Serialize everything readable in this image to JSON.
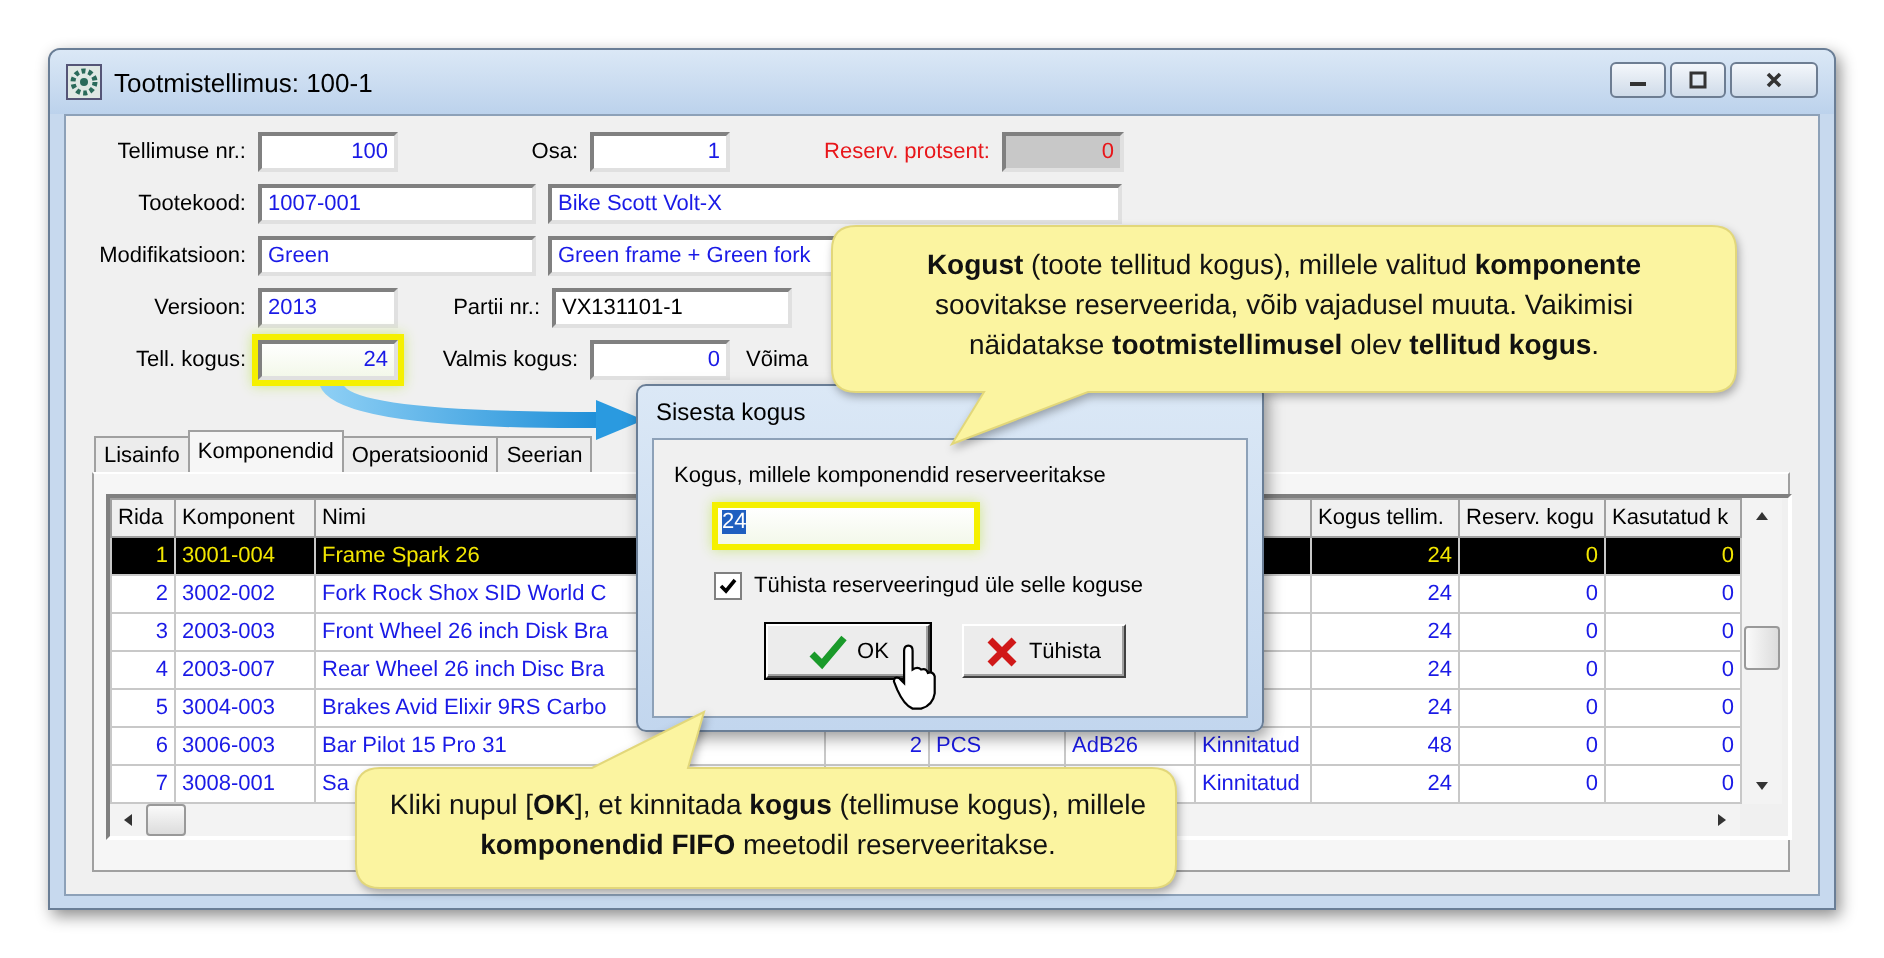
{
  "window": {
    "title": "Tootmistellimus: 100-1"
  },
  "form": {
    "rows": [
      [
        {
          "label": "Tellimuse nr.:",
          "value": "100",
          "kind": "number",
          "highlighted": false
        },
        {
          "label": "Osa:",
          "value": "1",
          "kind": "number",
          "highlighted": false
        },
        {
          "label": "Reserv. protsent:",
          "value": "0",
          "kind": "readonly",
          "highlighted": false
        }
      ],
      [
        {
          "label": "Tootekood:",
          "value": "1007-001",
          "kind": "text",
          "highlighted": false
        },
        {
          "value": "Bike Scott Volt-X",
          "kind": "text",
          "highlighted": false
        }
      ],
      [
        {
          "label": "Modifikatsioon:",
          "value": "Green",
          "kind": "text",
          "highlighted": false
        },
        {
          "value": "Green frame + Green fork",
          "kind": "text",
          "highlighted": false
        }
      ],
      [
        {
          "label": "Versioon:",
          "value": "2013",
          "kind": "text",
          "highlighted": false
        },
        {
          "label": "Partii nr.:",
          "value": "VX131101-1",
          "kind": "plain",
          "highlighted": false
        }
      ],
      [
        {
          "label": "Tell. kogus:",
          "value": "24",
          "kind": "number",
          "highlighted": true
        },
        {
          "label": "Valmis kogus:",
          "value": "0",
          "kind": "number",
          "highlighted": false
        },
        {
          "label": "Võima",
          "kind": "label_only"
        }
      ]
    ]
  },
  "tabs": [
    {
      "label": "Lisainfo",
      "selected": false
    },
    {
      "label": "Komponendid",
      "selected": true
    },
    {
      "label": "Operatsioonid",
      "selected": false
    },
    {
      "label": "Seerian",
      "selected": false
    }
  ],
  "table": {
    "columns": [
      "Rida",
      "Komponent",
      "Nimi",
      "Kogus tellim.",
      "Reserv. kogu",
      "Kasutatud k"
    ],
    "rows": [
      {
        "rida": "1",
        "komponent": "3001-004",
        "nimi": "Frame Spark 26",
        "kogus_tellim": "24",
        "reserv_kogu": "0",
        "kasutatud_k": "0",
        "selected": true
      },
      {
        "rida": "2",
        "komponent": "3002-002",
        "nimi": "Fork Rock Shox SID World C",
        "kogus_tellim": "24",
        "reserv_kogu": "0",
        "kasutatud_k": "0",
        "selected": false
      },
      {
        "rida": "3",
        "komponent": "2003-003",
        "nimi": "Front Wheel 26 inch Disk Bra",
        "kogus_tellim": "24",
        "reserv_kogu": "0",
        "kasutatud_k": "0",
        "selected": false
      },
      {
        "rida": "4",
        "komponent": "2003-007",
        "nimi": "Rear Wheel 26 inch Disc Bra",
        "kogus_tellim": "24",
        "reserv_kogu": "0",
        "kasutatud_k": "0",
        "selected": false
      },
      {
        "rida": "5",
        "komponent": "3004-003",
        "nimi": "Brakes Avid Elixir 9RS Carbo",
        "kogus_tellim": "24",
        "reserv_kogu": "0",
        "kasutatud_k": "0",
        "selected": false
      },
      {
        "rida": "6",
        "komponent": "3006-003",
        "nimi": "Bar Pilot 15 Pro 31",
        "column_4": "2",
        "column_5": "PCS",
        "column_6": "AdB26",
        "column_7": "Kinnitatud",
        "kogus_tellim": "48",
        "reserv_kogu": "0",
        "kasutatud_k": "0",
        "selected": false
      },
      {
        "rida": "7",
        "komponent": "3008-001",
        "nimi": "Sa",
        "column_7": "Kinnitatud",
        "kogus_tellim": "24",
        "reserv_kogu": "0",
        "kasutatud_k": "0",
        "selected": false
      }
    ]
  },
  "dialog": {
    "title": "Sisesta kogus",
    "label": "Kogus, millele komponendid reserveeritakse",
    "value": "24",
    "checkbox": {
      "label": "Tühista reserveeringud üle selle koguse",
      "checked": true
    },
    "buttons": [
      {
        "label": "OK",
        "kind": "ok"
      },
      {
        "label": "Tühista",
        "kind": "cancel"
      }
    ]
  },
  "callouts": [
    {
      "text": "**Kogust** (toote tellitud kogus), millele valitud **komponente** soovitakse reserveerida, võib vajadusel muuta. Vaikimisi näidatakse **tootmistellimusel** olev **tellitud kogus**."
    },
    {
      "text": "Kliki nupul [**OK**], et kinnitada **kogus** (tellimuse kogus), millele **komponendid**  **FIFO** meetodil reserveeritakse."
    }
  ]
}
